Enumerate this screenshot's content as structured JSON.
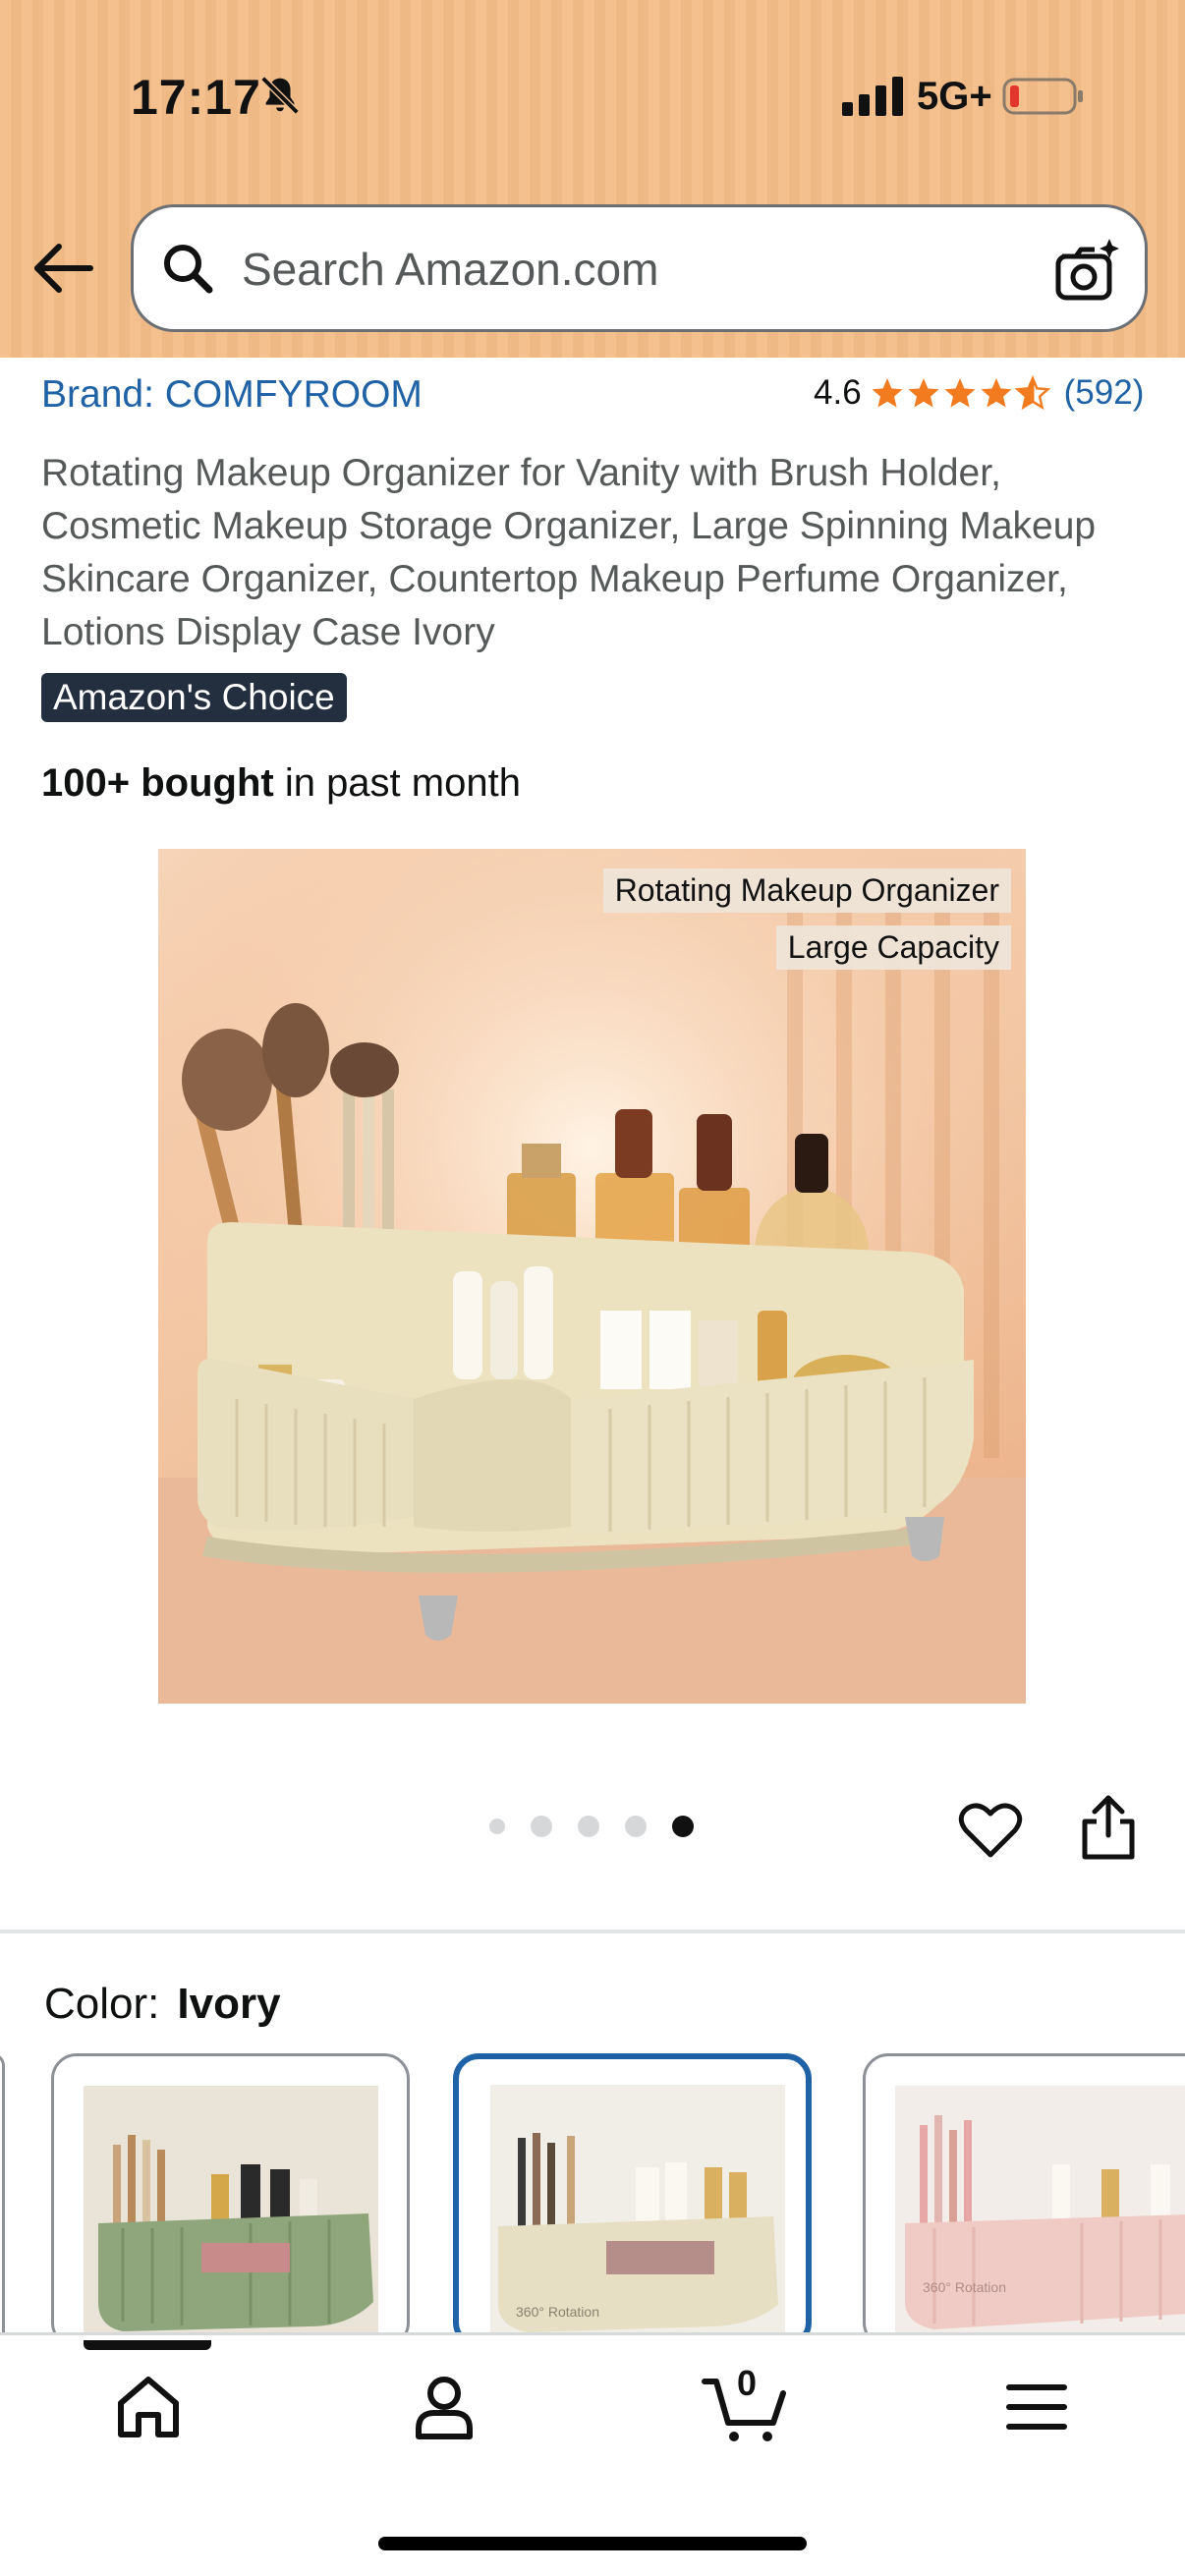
{
  "status_bar": {
    "time": "17:17",
    "network": "5G+"
  },
  "search": {
    "placeholder": "Search Amazon.com"
  },
  "product": {
    "brand": "Brand: COMFYROOM",
    "rating": "4.6",
    "rating_value": 4.6,
    "rating_count": "(592)",
    "title": "Rotating Makeup Organizer for Vanity with Brush Holder, Cosmetic Makeup Storage Organizer, Large Spinning Makeup Skincare Organizer, Countertop Makeup Perfume Organizer, Lotions Display Case Ivory",
    "badge": "Amazon's Choice",
    "bought_bold": "100+ bought",
    "bought_rest": " in past month",
    "image_labels": [
      "Rotating Makeup Organizer",
      "Large Capacity"
    ],
    "image_count": 5,
    "image_active_index": 5
  },
  "color": {
    "label": "Color:",
    "selected": "Ivory",
    "swatches": [
      {
        "name": "Green",
        "color": "#9db28a"
      },
      {
        "name": "Ivory",
        "color": "#e8e1c8",
        "selected": true
      },
      {
        "name": "Pink",
        "color": "#f2c9c2"
      }
    ]
  },
  "swatch_thumbnail_text": "360° Rotation",
  "bottom_nav": {
    "items": [
      "home-icon",
      "account-icon",
      "cart-icon",
      "menu-icon"
    ],
    "cart_count": "0"
  },
  "colors": {
    "link": "#1f62a5",
    "star": "#f27b1f",
    "badge_bg": "#232f3e",
    "selected_border": "#1f62a5"
  }
}
